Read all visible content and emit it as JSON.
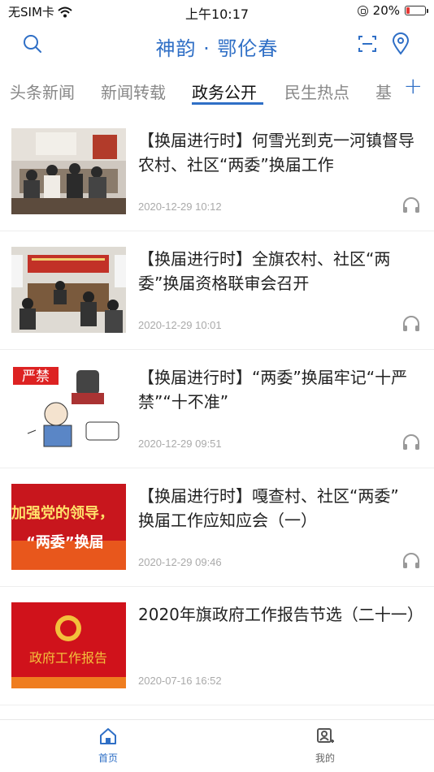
{
  "status_bar": {
    "carrier": "无SIM卡",
    "time": "上午10:17",
    "battery": "20%",
    "battery_level": 0.2,
    "battery_color": "#e53935"
  },
  "header": {
    "title": "神韵 · 鄂伦春",
    "icons": [
      "search-icon",
      "scan-icon",
      "location-icon"
    ],
    "accent_color": "#2f6fc6"
  },
  "tabs": {
    "items": [
      {
        "label": "头条新闻",
        "active": false
      },
      {
        "label": "新闻转载",
        "active": false
      },
      {
        "label": "政务公开",
        "active": true
      },
      {
        "label": "民生热点",
        "active": false
      },
      {
        "label": "基",
        "active": false
      }
    ],
    "add_label": "+"
  },
  "news": [
    {
      "title": "【换届进行时】何雪光到克一河镇督导农村、社区“两委”换届工作",
      "date": "2020-12-29 10:12",
      "audio": true,
      "thumb": "meeting-photo"
    },
    {
      "title": "【换届进行时】全旗农村、社区“两委”换届资格联审会召开",
      "date": "2020-12-29 10:01",
      "audio": true,
      "thumb": "meeting-room-photo"
    },
    {
      "title": "【换届进行时】“两委”换届牢记“十严禁”“十不准”",
      "date": "2020-12-29 09:51",
      "audio": true,
      "thumb": "cartoon-illustration",
      "thumb_text": "严禁"
    },
    {
      "title": "【换届进行时】嘎查村、社区“两委” 换届工作应知应会（一）",
      "date": "2020-12-29 09:46",
      "audio": true,
      "thumb": "red-banner",
      "thumb_text_1": "加强党的领导，",
      "thumb_text_2": "“两委”换届"
    },
    {
      "title": "2020年旗政府工作报告节选（二十一）",
      "date": "2020-07-16 16:52",
      "audio": false,
      "thumb": "report-cover",
      "thumb_text": "政府工作报告"
    }
  ],
  "bottom_nav": [
    {
      "label": "首页",
      "icon": "home-icon",
      "active": true
    },
    {
      "label": "我的",
      "icon": "profile-icon",
      "active": false
    }
  ]
}
